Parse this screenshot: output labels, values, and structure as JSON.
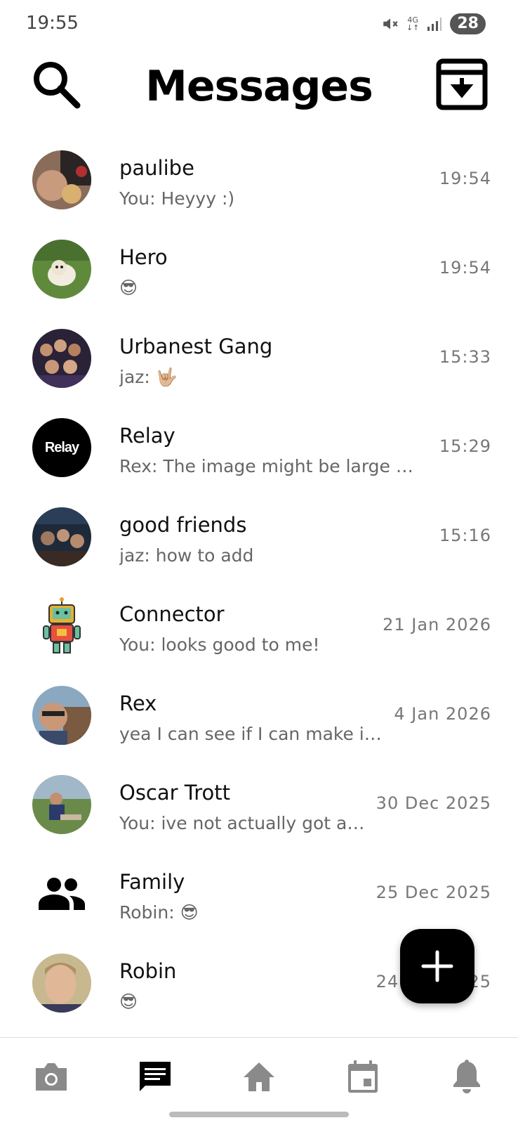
{
  "status_bar": {
    "time": "19:55",
    "network": "4G",
    "battery": "28"
  },
  "header": {
    "title": "Messages",
    "search_icon": "search-icon",
    "archive_icon": "archive-icon"
  },
  "chats": [
    {
      "name": "paulibe",
      "preview": "You: Heyyy :)",
      "time": "19:54",
      "avatar": "photo"
    },
    {
      "name": "Hero",
      "preview": "😎",
      "time": "19:54",
      "avatar": "photo"
    },
    {
      "name": "Urbanest Gang",
      "preview": "jaz: 🤟🏼",
      "time": "15:33",
      "avatar": "photo"
    },
    {
      "name": "Relay",
      "preview": "Rex: The image might be large an…",
      "time": "15:29",
      "avatar": "relay-logo",
      "avatar_text": "Relay"
    },
    {
      "name": "good friends",
      "preview": "jaz: how to add",
      "time": "15:16",
      "avatar": "photo"
    },
    {
      "name": "Connector",
      "preview": "You: looks good to me!",
      "time": "21 Jan 2026",
      "avatar": "robot-icon"
    },
    {
      "name": "Rex",
      "preview": "yea I can see if I can make i…",
      "time": "4 Jan 2026",
      "avatar": "photo"
    },
    {
      "name": "Oscar Trott",
      "preview": "You: ive not actually got a…",
      "time": "30 Dec 2025",
      "avatar": "photo"
    },
    {
      "name": "Family",
      "preview": "Robin: 😎",
      "time": "25 Dec 2025",
      "avatar": "group-icon"
    },
    {
      "name": "Robin",
      "preview": "😎",
      "time": "24 Dec 2025",
      "avatar": "photo"
    }
  ],
  "fab": {
    "icon": "plus-icon"
  },
  "bottom_nav": {
    "items": [
      {
        "name": "camera",
        "icon": "camera-icon"
      },
      {
        "name": "messages",
        "icon": "chat-icon",
        "active": true
      },
      {
        "name": "home",
        "icon": "home-icon"
      },
      {
        "name": "calendar",
        "icon": "calendar-icon"
      },
      {
        "name": "notifications",
        "icon": "bell-icon"
      }
    ]
  },
  "colors": {
    "active_nav": "#000000",
    "inactive_nav": "#8a8a8a",
    "time_text": "#777777",
    "preview_text": "#666666"
  }
}
